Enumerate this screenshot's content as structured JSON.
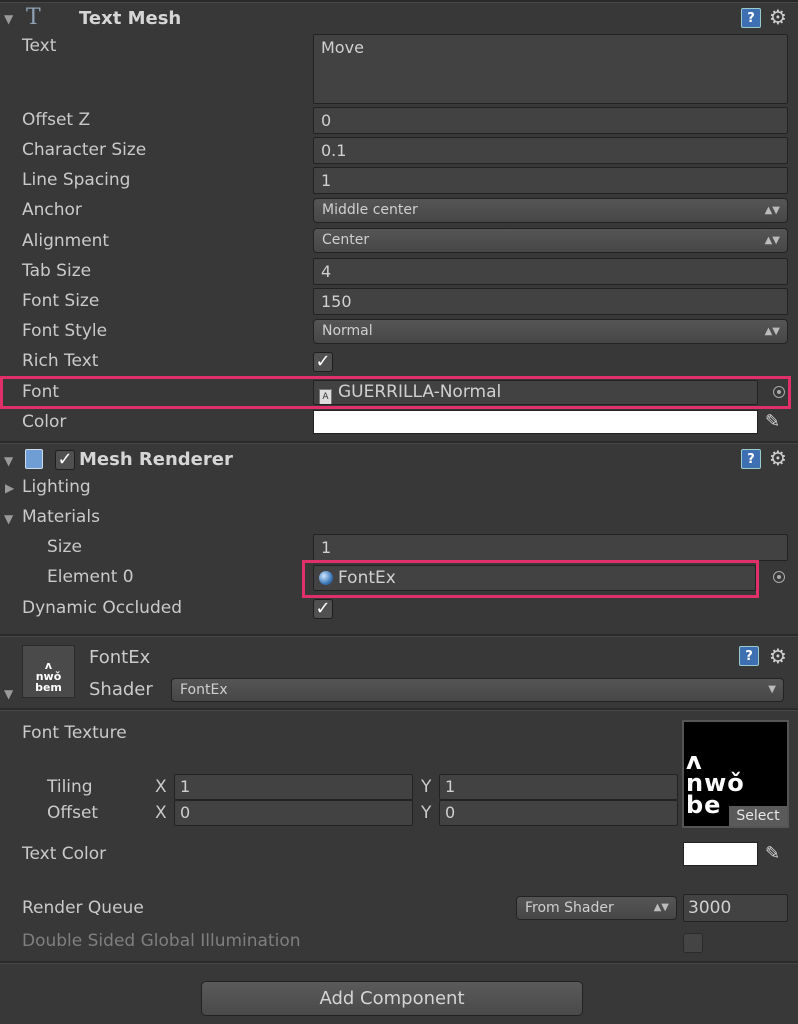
{
  "text_mesh": {
    "title": "Text Mesh",
    "text_label": "Text",
    "text_value": "Move",
    "offset_z_label": "Offset Z",
    "offset_z_value": "0",
    "char_size_label": "Character Size",
    "char_size_value": "0.1",
    "line_spacing_label": "Line Spacing",
    "line_spacing_value": "1",
    "anchor_label": "Anchor",
    "anchor_value": "Middle center",
    "alignment_label": "Alignment",
    "alignment_value": "Center",
    "tab_size_label": "Tab Size",
    "tab_size_value": "4",
    "font_size_label": "Font Size",
    "font_size_value": "150",
    "font_style_label": "Font Style",
    "font_style_value": "Normal",
    "rich_text_label": "Rich Text",
    "font_label": "Font",
    "font_value": "GUERRILLA-Normal",
    "color_label": "Color"
  },
  "mesh_renderer": {
    "title": "Mesh Renderer",
    "lighting_label": "Lighting",
    "materials_label": "Materials",
    "size_label": "Size",
    "size_value": "1",
    "element0_label": "Element 0",
    "element0_value": "FontEx",
    "dynamic_occluded_label": "Dynamic Occluded"
  },
  "material": {
    "name": "FontEx",
    "shader_label": "Shader",
    "shader_value": "FontEx",
    "thumb_text": "ʌ\nnwǒ\nbem",
    "font_texture_label": "Font Texture",
    "tiling_label": "Tiling",
    "offset_label": "Offset",
    "x_label": "X",
    "y_label": "Y",
    "tiling_x": "1",
    "tiling_y": "1",
    "offset_x": "0",
    "offset_y": "0",
    "select_label": "Select",
    "texture_art": "ʌ\nnwǒ\nbe",
    "text_color_label": "Text Color",
    "render_queue_label": "Render Queue",
    "render_queue_mode": "From Shader",
    "render_queue_value": "3000",
    "double_sided_label": "Double Sided Global Illumination"
  },
  "add_component_label": "Add Component"
}
